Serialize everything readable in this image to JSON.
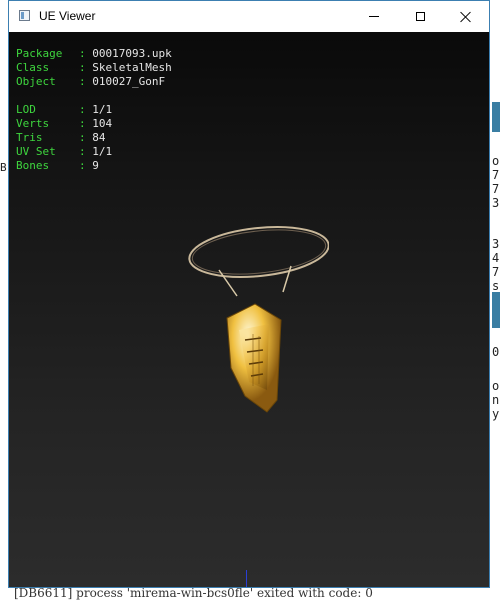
{
  "window": {
    "title": "UE Viewer"
  },
  "info": {
    "rows1": [
      {
        "key": "Package",
        "value": "00017093.upk"
      },
      {
        "key": "Class",
        "value": "SkeletalMesh"
      },
      {
        "key": "Object",
        "value": "010027_GonF"
      }
    ],
    "rows2": [
      {
        "key": "LOD",
        "value": "1/1"
      },
      {
        "key": "Verts",
        "value": "104"
      },
      {
        "key": "Tris",
        "value": "84"
      },
      {
        "key": "UV Set",
        "value": "1/1"
      },
      {
        "key": "Bones",
        "value": "9"
      }
    ]
  },
  "background_console": {
    "right_chars": [
      "o",
      "7",
      "7",
      "3",
      "3",
      "4",
      "7",
      "s",
      "0",
      "o",
      "n",
      "y"
    ],
    "left_char": "B",
    "bottom_line": "[DB6611] process 'mirema-win-bcs0fle' exited with code: 0"
  },
  "colors": {
    "label": "#3ed63e",
    "value": "#e6e6e6",
    "viewport_top": "#0a0a0a",
    "viewport_bottom": "#2c2c2c",
    "window_border": "#3c7fb1"
  },
  "icons": {
    "app": "app-window-icon",
    "minimize": "minimize-icon",
    "maximize": "maximize-icon",
    "close": "close-icon"
  }
}
